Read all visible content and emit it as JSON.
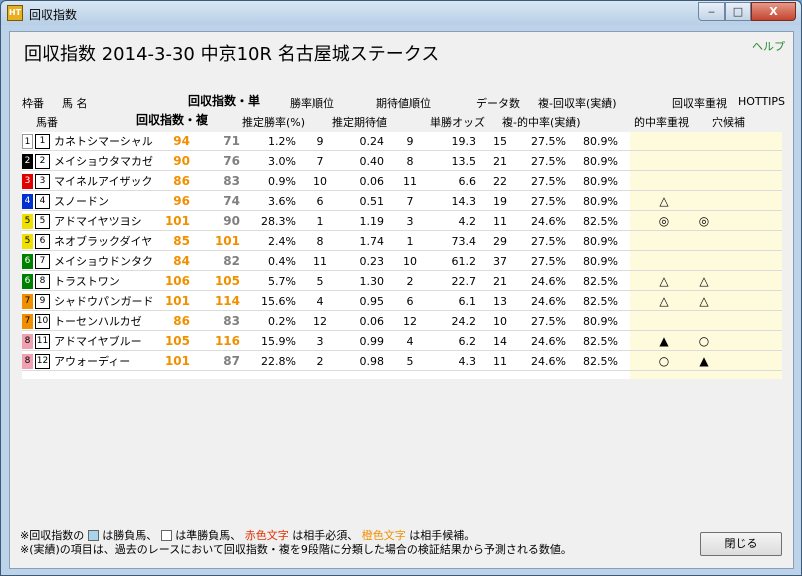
{
  "window": {
    "title": "回収指数",
    "app_icon": "HT",
    "min_label": "‒",
    "max_label": "□",
    "close_label": "X"
  },
  "header": {
    "title": "回収指数 2014-3-30 中京10R 名古屋城ステークス",
    "help": "ヘルプ"
  },
  "columns": {
    "waku": "枠番",
    "uma_name": "馬 名",
    "umaban": "馬番",
    "kaishu_tan": "回収指数・単",
    "kaishu_fuku": "回収指数・複",
    "shoritsu_rank": "勝率順位",
    "est_winrate": "推定勝率(%)",
    "kitai_rank": "期待値順位",
    "est_kitai": "推定期待値",
    "data_count": "データ数",
    "tansho_odds": "単勝オッズ",
    "fuku_kaishu": "複-回収率(実績)",
    "fuku_tekichu": "複-的中率(実績)",
    "kaishu_juushi": "回収率重視",
    "tekichu_juushi": "的中率重視",
    "hottips": "HOTTIPS",
    "anakoho": "穴候補"
  },
  "rows": [
    {
      "waku": "1",
      "num": "1",
      "name": "カネトシマーシャル",
      "tan": "94",
      "fuku": "71",
      "winrate": "1.2%",
      "win_rank": "9",
      "kitai": "0.24",
      "kitai_rank": "9",
      "odds": "19.3",
      "count": "15",
      "tekichu": "27.5%",
      "kaishu": "80.9%",
      "s1": "",
      "s2": ""
    },
    {
      "waku": "2",
      "num": "2",
      "name": "メイショウタマカゼ",
      "tan": "90",
      "fuku": "76",
      "winrate": "3.0%",
      "win_rank": "7",
      "kitai": "0.40",
      "kitai_rank": "8",
      "odds": "13.5",
      "count": "21",
      "tekichu": "27.5%",
      "kaishu": "80.9%",
      "s1": "",
      "s2": ""
    },
    {
      "waku": "3",
      "num": "3",
      "name": "マイネルアイザック",
      "tan": "86",
      "fuku": "83",
      "winrate": "0.9%",
      "win_rank": "10",
      "kitai": "0.06",
      "kitai_rank": "11",
      "odds": "6.6",
      "count": "22",
      "tekichu": "27.5%",
      "kaishu": "80.9%",
      "s1": "",
      "s2": ""
    },
    {
      "waku": "4",
      "num": "4",
      "name": "スノードン",
      "tan": "96",
      "fuku": "74",
      "winrate": "3.6%",
      "win_rank": "6",
      "kitai": "0.51",
      "kitai_rank": "7",
      "odds": "14.3",
      "count": "19",
      "tekichu": "27.5%",
      "kaishu": "80.9%",
      "s1": "△",
      "s2": ""
    },
    {
      "waku": "5",
      "num": "5",
      "name": "アドマイヤツヨシ",
      "tan": "101",
      "fuku": "90",
      "winrate": "28.3%",
      "win_rank": "1",
      "kitai": "1.19",
      "kitai_rank": "3",
      "odds": "4.2",
      "count": "11",
      "tekichu": "24.6%",
      "kaishu": "82.5%",
      "s1": "◎",
      "s2": "◎"
    },
    {
      "waku": "5",
      "num": "6",
      "name": "ネオブラックダイヤ",
      "tan": "85",
      "fuku": "101",
      "winrate": "2.4%",
      "win_rank": "8",
      "kitai": "1.74",
      "kitai_rank": "1",
      "odds": "73.4",
      "count": "29",
      "tekichu": "27.5%",
      "kaishu": "80.9%",
      "s1": "",
      "s2": ""
    },
    {
      "waku": "6",
      "num": "7",
      "name": "メイショウドンタク",
      "tan": "84",
      "fuku": "82",
      "winrate": "0.4%",
      "win_rank": "11",
      "kitai": "0.23",
      "kitai_rank": "10",
      "odds": "61.2",
      "count": "37",
      "tekichu": "27.5%",
      "kaishu": "80.9%",
      "s1": "",
      "s2": ""
    },
    {
      "waku": "6",
      "num": "8",
      "name": "トラストワン",
      "tan": "106",
      "fuku": "105",
      "winrate": "5.7%",
      "win_rank": "5",
      "kitai": "1.30",
      "kitai_rank": "2",
      "odds": "22.7",
      "count": "21",
      "tekichu": "24.6%",
      "kaishu": "82.5%",
      "s1": "△",
      "s2": "△"
    },
    {
      "waku": "7",
      "num": "9",
      "name": "シャドウパンガード",
      "tan": "101",
      "fuku": "114",
      "winrate": "15.6%",
      "win_rank": "4",
      "kitai": "0.95",
      "kitai_rank": "6",
      "odds": "6.1",
      "count": "13",
      "tekichu": "24.6%",
      "kaishu": "82.5%",
      "s1": "△",
      "s2": "△"
    },
    {
      "waku": "7",
      "num": "10",
      "name": "トーセンハルカゼ",
      "tan": "86",
      "fuku": "83",
      "winrate": "0.2%",
      "win_rank": "12",
      "kitai": "0.06",
      "kitai_rank": "12",
      "odds": "24.2",
      "count": "10",
      "tekichu": "27.5%",
      "kaishu": "80.9%",
      "s1": "",
      "s2": ""
    },
    {
      "waku": "8",
      "num": "11",
      "name": "アドマイヤブルー",
      "tan": "105",
      "fuku": "116",
      "winrate": "15.9%",
      "win_rank": "3",
      "kitai": "0.99",
      "kitai_rank": "4",
      "odds": "6.2",
      "count": "14",
      "tekichu": "24.6%",
      "kaishu": "82.5%",
      "s1": "▲",
      "s2": "○"
    },
    {
      "waku": "8",
      "num": "12",
      "name": "アウォーディー",
      "tan": "101",
      "fuku": "87",
      "winrate": "22.8%",
      "win_rank": "2",
      "kitai": "0.98",
      "kitai_rank": "5",
      "odds": "4.3",
      "count": "11",
      "tekichu": "24.6%",
      "kaishu": "82.5%",
      "s1": "○",
      "s2": "▲"
    }
  ],
  "colors": {
    "waku": {
      "1": "#ffffff",
      "2": "#000000",
      "3": "#e00000",
      "4": "#0030d0",
      "5": "#f0e000",
      "6": "#008000",
      "7": "#f09000",
      "8": "#f0a0b0"
    },
    "orange": "#f09000",
    "red": "#e03000",
    "gray": "#808080"
  },
  "notes": {
    "line1_a": "※回収指数の",
    "line1_b": "は勝負馬、",
    "line1_c": "は準勝負馬、",
    "line1_red": "赤色文字",
    "line1_d": "は相手必須、",
    "line1_orange": "橙色文字",
    "line1_e": "は相手候補。",
    "line2": "※(実績)の項目は、過去のレースにおいて回収指数・複を9段階に分類した場合の検証結果から予測される数値。"
  },
  "close_button": "閉じる"
}
